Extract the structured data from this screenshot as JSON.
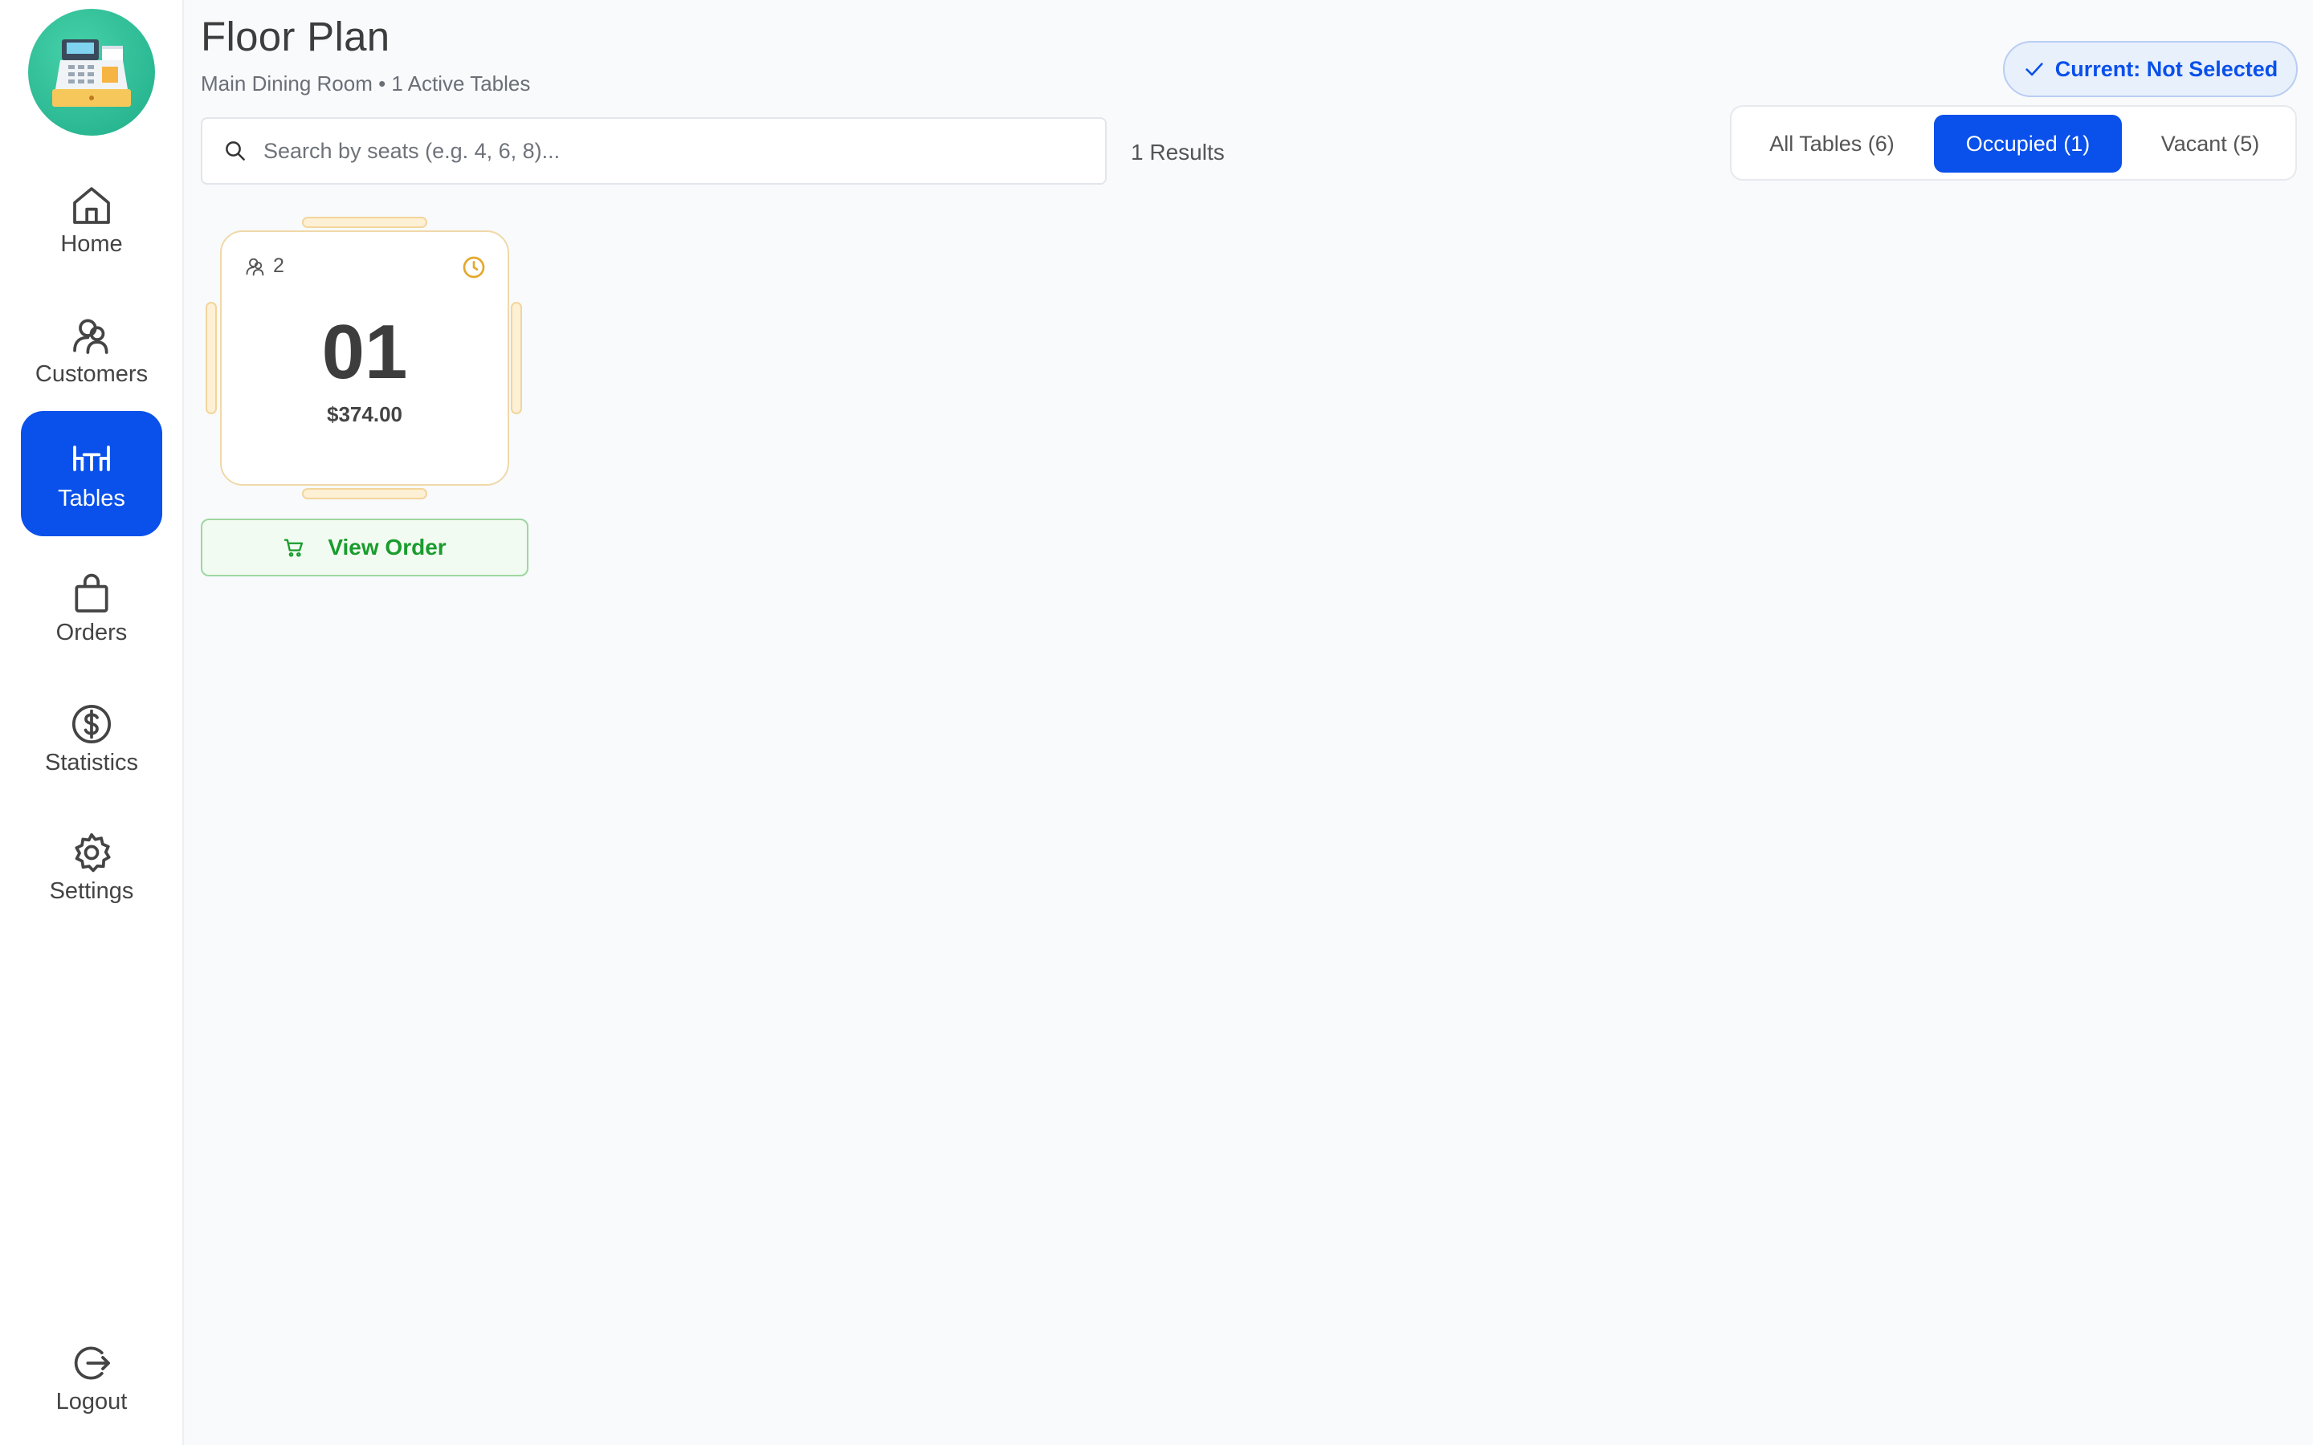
{
  "sidebar": {
    "items": [
      {
        "label": "Home"
      },
      {
        "label": "Customers"
      },
      {
        "label": "Tables"
      },
      {
        "label": "Orders"
      },
      {
        "label": "Statistics"
      },
      {
        "label": "Settings"
      }
    ],
    "logout_label": "Logout",
    "active_item": "Tables"
  },
  "header": {
    "title": "Floor Plan",
    "subtitle": "Main Dining Room • 1 Active Tables",
    "current_label": "Current: Not Selected"
  },
  "search": {
    "placeholder": "Search by seats (e.g. 4, 6, 8)...",
    "value": "",
    "results_label": "1 Results"
  },
  "filters": [
    {
      "label": "All Tables (6)",
      "active": false
    },
    {
      "label": "Occupied (1)",
      "active": true
    },
    {
      "label": "Vacant (5)",
      "active": false
    }
  ],
  "tables": [
    {
      "seats": "2",
      "number": "01",
      "amount": "$374.00",
      "status": "occupied",
      "action_label": "View Order"
    }
  ],
  "colors": {
    "accent": "#0a50ea",
    "logo": "#2bbf95",
    "occupied_border": "#f0d8a8",
    "chair": "#fdf0d5",
    "action_green": "#1a9c2e",
    "clock": "#e5a82a"
  }
}
